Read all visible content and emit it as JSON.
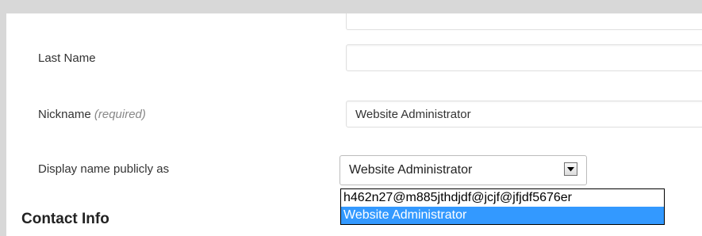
{
  "form": {
    "last_name": {
      "label": "Last Name",
      "value": ""
    },
    "nickname": {
      "label": "Nickname",
      "required_note": "(required)",
      "value": "Website Administrator"
    },
    "display_name": {
      "label": "Display name publicly as",
      "selected": "Website Administrator",
      "options": [
        "h462n27@m885jthdjdf@jcjf@jfjdf5676er",
        "Website Administrator"
      ],
      "highlighted_index": 1
    }
  },
  "sections": {
    "contact_info": "Contact Info"
  },
  "colors": {
    "page_background": "#d8d8d8",
    "panel_background": "#ffffff",
    "highlight": "#3399ff"
  },
  "icons": {
    "dropdown_arrow": "chevron-down-icon"
  }
}
